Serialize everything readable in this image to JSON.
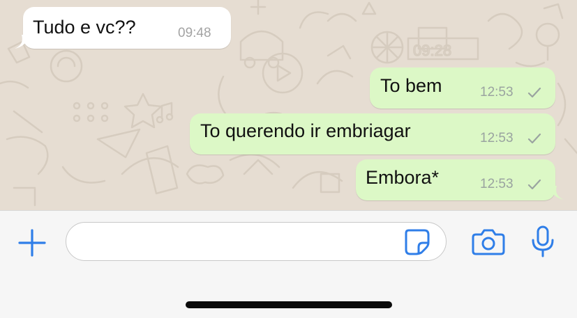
{
  "theme": {
    "incoming_bubble": "#ffffff",
    "outgoing_bubble": "#dcf8c6",
    "accent": "#2f7ee8",
    "wallpaper": "#e6ddd2"
  },
  "messages": [
    {
      "direction": "incoming",
      "text": "Tudo e vc??",
      "time": "09:48"
    },
    {
      "direction": "outgoing",
      "text": "To bem",
      "time": "12:53",
      "status": "sent-check-icon"
    },
    {
      "direction": "outgoing",
      "text": "To querendo ir embriagar",
      "time": "12:53",
      "status": "sent-check-icon"
    },
    {
      "direction": "outgoing",
      "text": "Embora*",
      "time": "12:53",
      "status": "sent-check-icon"
    }
  ],
  "composer": {
    "value": "",
    "placeholder": "",
    "icons": [
      "plus-icon",
      "sticker-icon",
      "camera-icon",
      "microphone-icon"
    ]
  }
}
